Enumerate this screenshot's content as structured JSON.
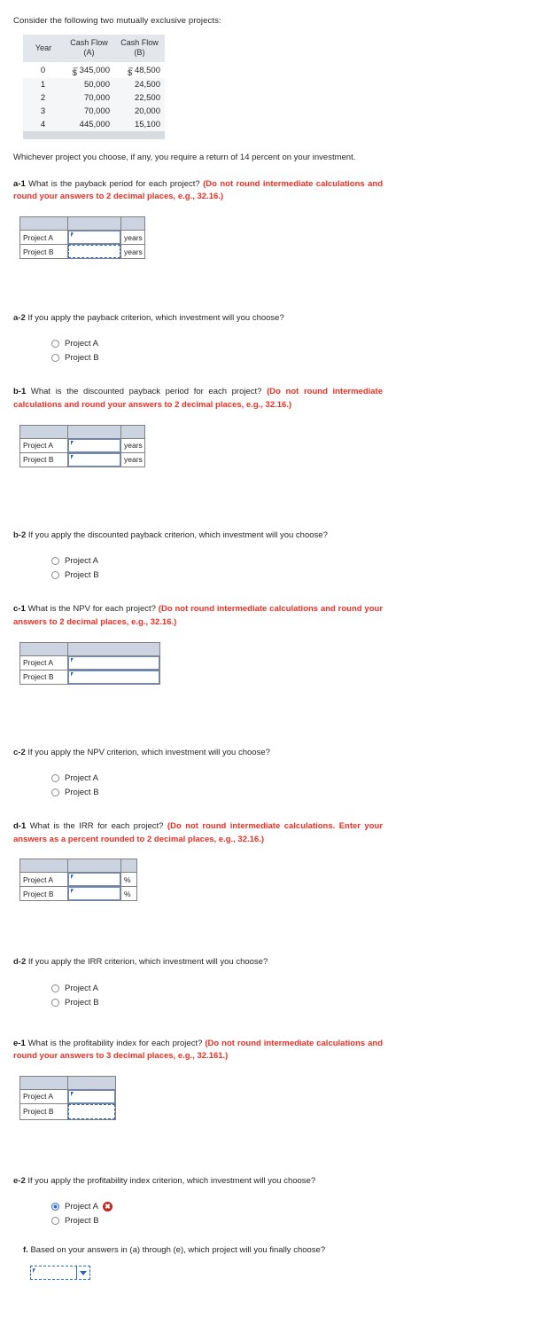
{
  "intro": "Consider the following two mutually exclusive projects:",
  "cash_flow_table": {
    "columns": [
      "Year",
      "Cash Flow (A)",
      "Cash Flow (B)"
    ],
    "header": {
      "year": "Year",
      "a_line1": "Cash Flow",
      "a_line2": "(A)",
      "b_line1": "Cash Flow",
      "b_line2": "(B)"
    },
    "currency": "$",
    "minus": "–",
    "rows": [
      {
        "year": "0",
        "a": "345,000",
        "b": "48,500",
        "negative": true
      },
      {
        "year": "1",
        "a": "50,000",
        "b": "24,500",
        "negative": false
      },
      {
        "year": "2",
        "a": "70,000",
        "b": "22,500",
        "negative": false
      },
      {
        "year": "3",
        "a": "70,000",
        "b": "20,000",
        "negative": false
      },
      {
        "year": "4",
        "a": "445,000",
        "b": "15,100",
        "negative": false
      }
    ]
  },
  "requirement_text": "Whichever project you choose, if any, you require a return of 14 percent on your investment.",
  "questions": {
    "a1": {
      "label": "a-1",
      "text": "What is the payback period for each project?",
      "instruction": "(Do not round intermediate calculations and round your answers to 2 decimal places, e.g., 32.16.)"
    },
    "a2": {
      "label": "a-2",
      "text": "If you apply the payback criterion, which investment will you choose?"
    },
    "b1": {
      "label": "b-1",
      "text": "What is the discounted payback period for each project?",
      "instruction": "(Do not round intermediate calculations and round your answers to 2 decimal places, e.g., 32.16.)"
    },
    "b2": {
      "label": "b-2",
      "text": "If you apply the discounted payback criterion, which investment will you choose?"
    },
    "c1": {
      "label": "c-1",
      "text": "What is the NPV for each project?",
      "instruction": "(Do not round intermediate calculations and round your answers to 2 decimal places, e.g., 32.16.)"
    },
    "c2": {
      "label": "c-2",
      "text": "If you apply the NPV criterion, which investment will you choose?"
    },
    "d1": {
      "label": "d-1",
      "text": "What is the IRR for each project?",
      "instruction": "(Do not round intermediate calculations. Enter your answers as a percent rounded to 2 decimal places, e.g., 32.16.)"
    },
    "d2": {
      "label": "d-2",
      "text": "If you apply the IRR criterion, which investment will you choose?"
    },
    "e1": {
      "label": "e-1",
      "text": "What is the profitability index for each project?",
      "instruction": "(Do not round intermediate calculations and round your answers to 3 decimal places, e.g., 32.161.)"
    },
    "e2": {
      "label": "e-2",
      "text": "If you apply the profitability index criterion, which investment will you choose?"
    },
    "f": {
      "label": "f.",
      "text": "Based on your answers in (a) through (e), which project will you finally choose?"
    }
  },
  "answer_rows": {
    "project_a": "Project A",
    "project_b": "Project B"
  },
  "units": {
    "years": "years",
    "percent": "%"
  },
  "inputs": {
    "a1_a": "",
    "a1_b": "",
    "b1_a": "",
    "b1_b": "",
    "c1_a": "",
    "c1_b": "",
    "d1_a": "",
    "d1_b": "",
    "e1_a": "",
    "e1_b": "",
    "final_select": ""
  },
  "radio_options": {
    "a": "Project A",
    "b": "Project B"
  },
  "selection_state": {
    "a2": "none",
    "b2": "none",
    "c2": "none",
    "d2": "none",
    "e2": "Project A"
  },
  "error_icon": "✖",
  "colors": {
    "instruction_red": "#ee2f24",
    "table_header": "#e3e7ec",
    "answer_header": "#ccd4e1",
    "input_border": "#6b8cc4",
    "focus_border": "#2b63c4",
    "error_badge": "#c0251f",
    "radio_checked": "#2f6fd0"
  }
}
